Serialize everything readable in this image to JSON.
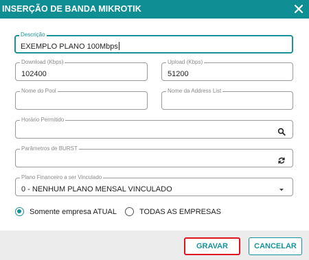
{
  "dialog": {
    "title": "INSERÇÃO DE BANDA MIKROTIK",
    "close_icon": "close-icon"
  },
  "fields": {
    "descricao": {
      "label": "Descrição",
      "value": "EXEMPLO PLANO 100Mbps"
    },
    "download": {
      "label": "Download (Kbps)",
      "value": "102400"
    },
    "upload": {
      "label": "Upload (Kbps)",
      "value": "51200"
    },
    "pool": {
      "label": "Nome do Pool",
      "value": ""
    },
    "address_list": {
      "label": "Nome da Address List",
      "value": ""
    },
    "horario": {
      "label": "Horário Permitido",
      "value": "",
      "icon": "search-icon"
    },
    "burst": {
      "label": "Parâmetros de BURST",
      "value": "",
      "icon": "refresh-icon"
    },
    "plano": {
      "label": "Plano Financeiro a ser Vinculado",
      "value": "0 - NENHUM PLANO MENSAL VINCULADO",
      "icon": "dropdown-arrow-icon"
    }
  },
  "scope": {
    "options": [
      {
        "label": "Somente empresa ATUAL",
        "selected": true
      },
      {
        "label": "TODAS AS EMPRESAS",
        "selected": false
      }
    ]
  },
  "footer": {
    "save_label": "GRAVAR",
    "cancel_label": "CANCELAR"
  },
  "colors": {
    "header": "#0f8f94",
    "accent": "#17929a",
    "highlight": "#e0141e"
  }
}
